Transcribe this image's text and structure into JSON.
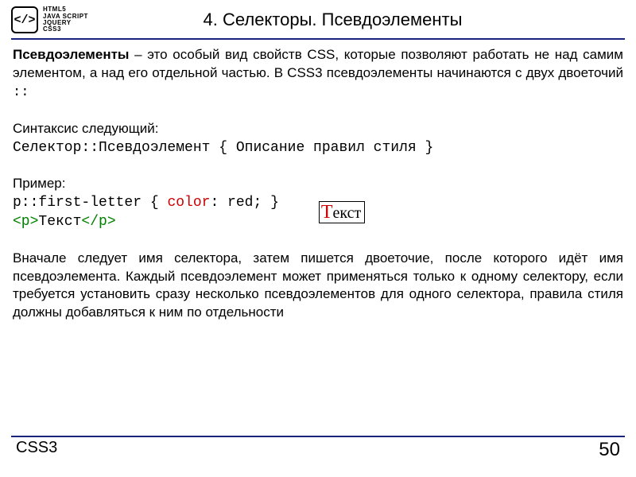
{
  "logo": {
    "symbol": "</>",
    "line1": "HTML5",
    "line2": "JAVA SCRIPT",
    "line3": "JQUERY",
    "line4": "CSS3"
  },
  "title": "4. Селекторы. Псевдоэлементы",
  "intro": {
    "term": "Псевдоэлементы",
    "text": " – это особый вид свойств CSS, которые позволяют работать не над самим элементом, а над его отдельной частью. В CSS3 псевдоэлементы начинаются с двух двоеточий ",
    "symbol": "::"
  },
  "syntax": {
    "label": "Синтаксис следующий:",
    "code": "Селектор::Псевдоэлемент { Описание правил стиля }"
  },
  "example": {
    "label": "Пример:",
    "code_pre": "p::first-letter { ",
    "code_prop": "color",
    "code_post": ": red; }",
    "tag_open": "<p>",
    "tag_text": "Текст",
    "tag_close": "</p>",
    "rendered_first": "Т",
    "rendered_rest": "екст"
  },
  "description": "Вначале следует имя селектора, затем пишется двоеточие, после которого идёт имя псевдоэлемента. Каждый псевдоэлемент может применяться только к одному селектору, если требуется установить сразу несколько псевдоэлементов для одного селектора, правила стиля должны добавляться к ним по отдельности",
  "footer": {
    "label": "CSS3",
    "page": "50"
  }
}
